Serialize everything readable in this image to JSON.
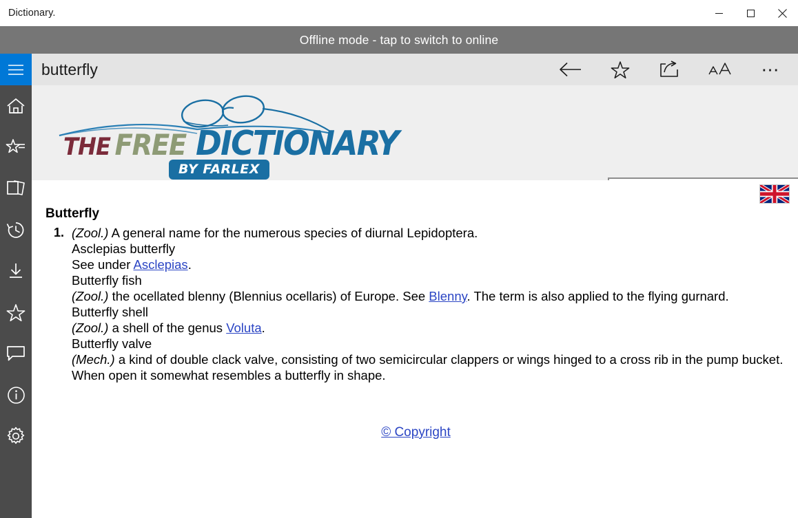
{
  "window": {
    "title": "Dictionary.",
    "controls": [
      {
        "name": "minimize",
        "label": "—"
      },
      {
        "name": "maximize",
        "label": "□"
      },
      {
        "name": "close",
        "label": "✕"
      }
    ]
  },
  "banner": {
    "text": "Offline mode - tap to switch to online",
    "background": "#767676",
    "color": "#ffffff"
  },
  "sidebar": {
    "accent": "#0078d7",
    "background": "#4b4b4b",
    "menu_label": "menu",
    "items": [
      {
        "icon": "home-icon",
        "label": "Home"
      },
      {
        "icon": "star-list-icon",
        "label": "Word lists"
      },
      {
        "icon": "cards-icon",
        "label": "Flashcards"
      },
      {
        "icon": "history-icon",
        "label": "History"
      },
      {
        "icon": "download-icon",
        "label": "Downloads"
      },
      {
        "icon": "star-icon",
        "label": "Rate"
      },
      {
        "icon": "feedback-icon",
        "label": "Feedback"
      },
      {
        "icon": "info-icon",
        "label": "About"
      },
      {
        "icon": "settings-gear-icon",
        "label": "Settings"
      }
    ]
  },
  "appbar": {
    "title": "butterfly",
    "background": "#e4e4e4",
    "actions": [
      {
        "icon": "back-arrow-icon",
        "label": "Back"
      },
      {
        "icon": "favorite-star-icon",
        "label": "Favorite"
      },
      {
        "icon": "share-icon",
        "label": "Share"
      },
      {
        "icon": "font-size-icon",
        "label": "AA"
      },
      {
        "icon": "more-ellipsis-icon",
        "label": "More"
      }
    ]
  },
  "logo": {
    "the": "THE",
    "free": "FREE",
    "dictionary": "DICTIONARY",
    "byline": "BY FARLEX",
    "colors": {
      "the": "#7b2b3a",
      "free": "#8e9b76",
      "dictionary": "#1a6fa3",
      "badge": "#1a6fa3"
    }
  },
  "search": {
    "value": "butterfly",
    "placeholder": "",
    "icon": "search-magnifier-icon"
  },
  "content": {
    "locale_flag": "uk-flag",
    "headword": "Butterfly",
    "sense_number": "1.",
    "lines": [
      {
        "label": "(Zool.)",
        "text": " A general name for the numerous species of diurnal Lepidoptera."
      },
      {
        "label": "",
        "text": "Asclepias butterfly"
      },
      {
        "label": "",
        "text": "See under ",
        "link": "Asclepias",
        "after": "."
      },
      {
        "label": "",
        "text": "Butterfly fish"
      },
      {
        "label": "(Zool.)",
        "text": " the ocellated blenny (Blennius ocellaris) of Europe. See ",
        "link": "Blenny",
        "after": ". The term is also applied to the flying gurnard."
      },
      {
        "label": "",
        "text": "Butterfly shell"
      },
      {
        "label": "(Zool.)",
        "text": " a shell of the genus ",
        "link": "Voluta",
        "after": "."
      },
      {
        "label": "",
        "text": "Butterfly valve"
      },
      {
        "label": "(Mech.)",
        "text": " a kind of double clack valve, consisting of two semicircular clappers or wings hinged to a cross rib in the pump bucket. When open it somewhat resembles a butterfly in shape."
      }
    ],
    "copyright": "© Copyright",
    "link_color": "#2b45c4"
  }
}
